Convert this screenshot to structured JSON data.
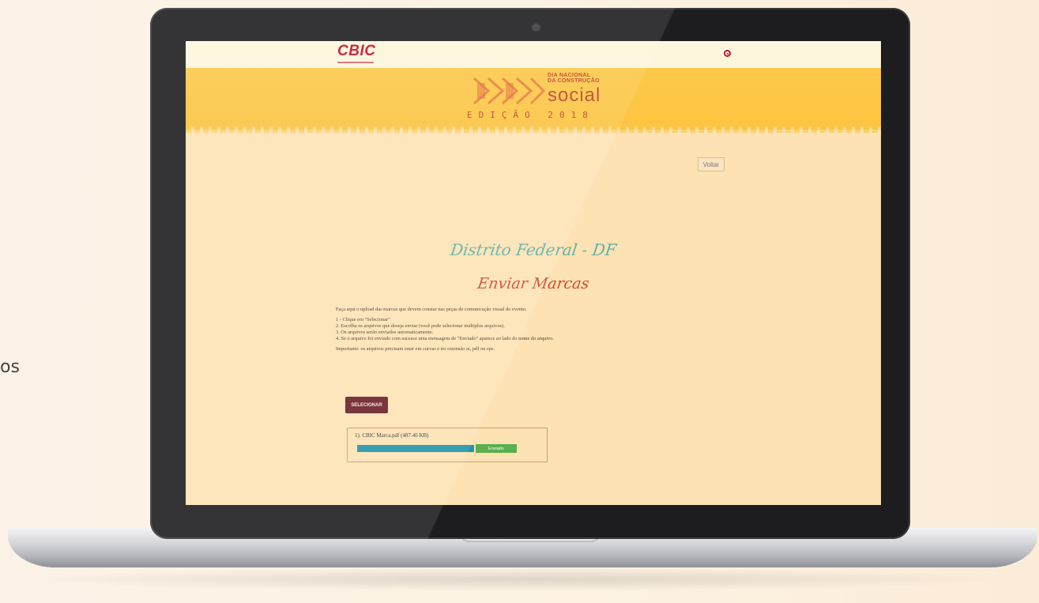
{
  "background_text": "os",
  "header": {
    "brand": "CBIC",
    "social_icon": "instagram-icon",
    "accent_color": "#c8102e"
  },
  "banner": {
    "logo_small_lines": "DIA NACIONAL\nDA CONSTRUÇÃO",
    "logo_big": "social",
    "edition": "EDIÇÃO 2018",
    "color": "#fcc440"
  },
  "nav": {
    "back_label": "Voltar"
  },
  "page": {
    "region": "Distrito Federal - DF",
    "title": "Enviar Marcas",
    "intro": "Faça aqui o upload das marcas que devem constar nas peças de comunicação visual do evento.",
    "steps": [
      "1 - Clique em \"Selecionar\"",
      "2. Escolha os arquivos que deseja enviar (você pode selecionar múltiplos arquivos).",
      "3. Os arquivos serão enviados automaticamente.",
      "4. Se o arquivo foi enviado com sucesso uma mensagem de \"Enviado\" aparece ao lado do nome do arquivo."
    ],
    "important": "Importante: os arquivos precisam estar em curvas e ter extensão ai, pdf ou eps.",
    "select_button": "SELECIONAR"
  },
  "upload": {
    "files": [
      {
        "label": "1). CBIC Marca.pdf (487.46 KB)",
        "progress": 1.0,
        "status": "Enviado"
      }
    ]
  }
}
